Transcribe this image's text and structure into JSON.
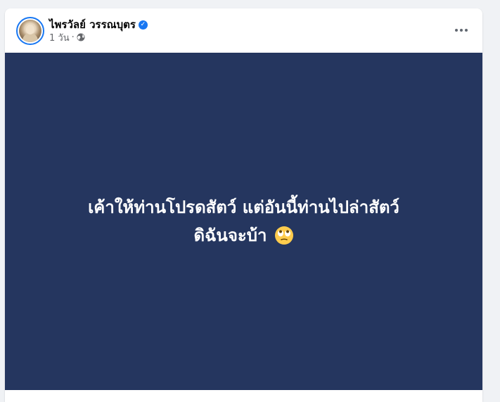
{
  "post": {
    "author_name": "ไพรวัลย์ วรรณบุตร",
    "timestamp": "1 วัน",
    "separator": "·",
    "privacy_icon": "globe-icon",
    "verified_icon": "verified-badge-icon",
    "more_icon": "more-options-icon",
    "content_line1": "เค้าให้ท่านโปรดสัตว์ แต่อันนี้ท่านไปล่าสัตว์",
    "content_line2": "ดิฉันจะบ้า",
    "emoji_icon": "face-with-rolling-eyes-icon",
    "background_color": "#25365f"
  },
  "colors": {
    "accent": "#1877f2",
    "page_background": "#f0f2f5"
  }
}
